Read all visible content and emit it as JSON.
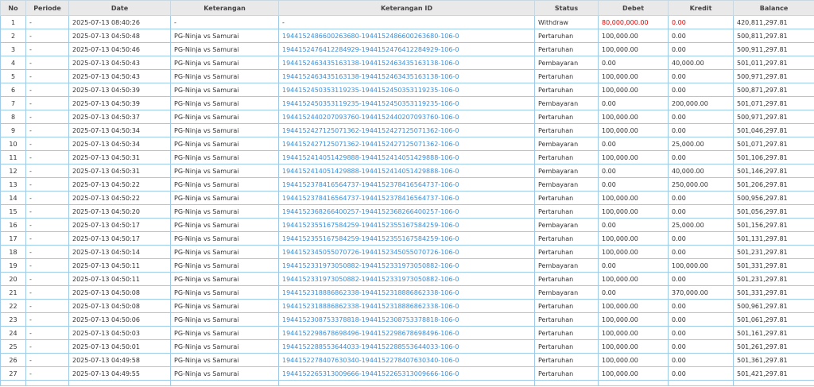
{
  "headers": [
    "No",
    "Periode",
    "Date",
    "Keterangan",
    "Keterangan ID",
    "Status",
    "Debet",
    "Kredit",
    "Balance"
  ],
  "rows": [
    {
      "no": "1",
      "periode": "-",
      "date": "2025-07-13 08:40:26",
      "keterangan": "-",
      "keterangan_id": "-",
      "status": "Withdraw",
      "debet": "80,000,000.00",
      "kredit": "0.00",
      "balance": "420,811,297.81"
    },
    {
      "no": "2",
      "periode": "-",
      "date": "2025-07-13 04:50:48",
      "keterangan": "PG-Ninja vs Samurai",
      "keterangan_id": "1944152486600263680-1944152486600263680-106-0",
      "status": "Pertaruhan",
      "debet": "100,000.00",
      "kredit": "0.00",
      "balance": "500,811,297.81"
    },
    {
      "no": "3",
      "periode": "-",
      "date": "2025-07-13 04:50:46",
      "keterangan": "PG-Ninja vs Samurai",
      "keterangan_id": "1944152476412284929-1944152476412284929-106-0",
      "status": "Pertaruhan",
      "debet": "100,000.00",
      "kredit": "0.00",
      "balance": "500,911,297.81"
    },
    {
      "no": "4",
      "periode": "-",
      "date": "2025-07-13 04:50:43",
      "keterangan": "PG-Ninja vs Samurai",
      "keterangan_id": "1944152463435163138-1944152463435163138-106-0",
      "status": "Pembayaran",
      "debet": "0.00",
      "kredit": "40,000.00",
      "balance": "501,011,297.81"
    },
    {
      "no": "5",
      "periode": "-",
      "date": "2025-07-13 04:50:43",
      "keterangan": "PG-Ninja vs Samurai",
      "keterangan_id": "1944152463435163138-1944152463435163138-106-0",
      "status": "Pertaruhan",
      "debet": "100,000.00",
      "kredit": "0.00",
      "balance": "500,971,297.81"
    },
    {
      "no": "6",
      "periode": "-",
      "date": "2025-07-13 04:50:39",
      "keterangan": "PG-Ninja vs Samurai",
      "keterangan_id": "1944152450353119235-1944152450353119235-106-0",
      "status": "Pertaruhan",
      "debet": "100,000.00",
      "kredit": "0.00",
      "balance": "500,871,297.81"
    },
    {
      "no": "7",
      "periode": "-",
      "date": "2025-07-13 04:50:39",
      "keterangan": "PG-Ninja vs Samurai",
      "keterangan_id": "1944152450353119235-1944152450353119235-106-0",
      "status": "Pembayaran",
      "debet": "0.00",
      "kredit": "200,000.00",
      "balance": "501,071,297.81"
    },
    {
      "no": "8",
      "periode": "-",
      "date": "2025-07-13 04:50:37",
      "keterangan": "PG-Ninja vs Samurai",
      "keterangan_id": "1944152440207093760-1944152440207093760-106-0",
      "status": "Pertaruhan",
      "debet": "100,000.00",
      "kredit": "0.00",
      "balance": "500,971,297.81"
    },
    {
      "no": "9",
      "periode": "-",
      "date": "2025-07-13 04:50:34",
      "keterangan": "PG-Ninja vs Samurai",
      "keterangan_id": "1944152427125071362-1944152427125071362-106-0",
      "status": "Pertaruhan",
      "debet": "100,000.00",
      "kredit": "0.00",
      "balance": "501,046,297.81"
    },
    {
      "no": "10",
      "periode": "-",
      "date": "2025-07-13 04:50:34",
      "keterangan": "PG-Ninja vs Samurai",
      "keterangan_id": "1944152427125071362-1944152427125071362-106-0",
      "status": "Pembayaran",
      "debet": "0.00",
      "kredit": "25,000.00",
      "balance": "501,071,297.81"
    },
    {
      "no": "11",
      "periode": "-",
      "date": "2025-07-13 04:50:31",
      "keterangan": "PG-Ninja vs Samurai",
      "keterangan_id": "1944152414051429888-1944152414051429888-106-0",
      "status": "Pertaruhan",
      "debet": "100,000.00",
      "kredit": "0.00",
      "balance": "501,106,297.81"
    },
    {
      "no": "12",
      "periode": "-",
      "date": "2025-07-13 04:50:31",
      "keterangan": "PG-Ninja vs Samurai",
      "keterangan_id": "1944152414051429888-1944152414051429888-106-0",
      "status": "Pembayaran",
      "debet": "0.00",
      "kredit": "40,000.00",
      "balance": "501,146,297.81"
    },
    {
      "no": "13",
      "periode": "-",
      "date": "2025-07-13 04:50:22",
      "keterangan": "PG-Ninja vs Samurai",
      "keterangan_id": "1944152378416564737-1944152378416564737-106-0",
      "status": "Pembayaran",
      "debet": "0.00",
      "kredit": "250,000.00",
      "balance": "501,206,297.81"
    },
    {
      "no": "14",
      "periode": "-",
      "date": "2025-07-13 04:50:22",
      "keterangan": "PG-Ninja vs Samurai",
      "keterangan_id": "1944152378416564737-1944152378416564737-106-0",
      "status": "Pertaruhan",
      "debet": "100,000.00",
      "kredit": "0.00",
      "balance": "500,956,297.81"
    },
    {
      "no": "15",
      "periode": "-",
      "date": "2025-07-13 04:50:20",
      "keterangan": "PG-Ninja vs Samurai",
      "keterangan_id": "1944152368266400257-1944152368266400257-106-0",
      "status": "Pertaruhan",
      "debet": "100,000.00",
      "kredit": "0.00",
      "balance": "501,056,297.81"
    },
    {
      "no": "16",
      "periode": "-",
      "date": "2025-07-13 04:50:17",
      "keterangan": "PG-Ninja vs Samurai",
      "keterangan_id": "1944152355167584259-1944152355167584259-106-0",
      "status": "Pembayaran",
      "debet": "0.00",
      "kredit": "25,000.00",
      "balance": "501,156,297.81"
    },
    {
      "no": "17",
      "periode": "-",
      "date": "2025-07-13 04:50:17",
      "keterangan": "PG-Ninja vs Samurai",
      "keterangan_id": "1944152355167584259-1944152355167584259-106-0",
      "status": "Pertaruhan",
      "debet": "100,000.00",
      "kredit": "0.00",
      "balance": "501,131,297.81"
    },
    {
      "no": "18",
      "periode": "-",
      "date": "2025-07-13 04:50:14",
      "keterangan": "PG-Ninja vs Samurai",
      "keterangan_id": "1944152345055070726-1944152345055070726-106-0",
      "status": "Pertaruhan",
      "debet": "100,000.00",
      "kredit": "0.00",
      "balance": "501,231,297.81"
    },
    {
      "no": "19",
      "periode": "-",
      "date": "2025-07-13 04:50:11",
      "keterangan": "PG-Ninja vs Samurai",
      "keterangan_id": "1944152331973050882-1944152331973050882-106-0",
      "status": "Pembayaran",
      "debet": "0.00",
      "kredit": "100,000.00",
      "balance": "501,331,297.81"
    },
    {
      "no": "20",
      "periode": "-",
      "date": "2025-07-13 04:50:11",
      "keterangan": "PG-Ninja vs Samurai",
      "keterangan_id": "1944152331973050882-1944152331973050882-106-0",
      "status": "Pertaruhan",
      "debet": "100,000.00",
      "kredit": "0.00",
      "balance": "501,231,297.81"
    },
    {
      "no": "21",
      "periode": "-",
      "date": "2025-07-13 04:50:08",
      "keterangan": "PG-Ninja vs Samurai",
      "keterangan_id": "1944152318886862338-1944152318886862338-106-0",
      "status": "Pembayaran",
      "debet": "0.00",
      "kredit": "370,000.00",
      "balance": "501,331,297.81"
    },
    {
      "no": "22",
      "periode": "-",
      "date": "2025-07-13 04:50:08",
      "keterangan": "PG-Ninja vs Samurai",
      "keterangan_id": "1944152318886862338-1944152318886862338-106-0",
      "status": "Pertaruhan",
      "debet": "100,000.00",
      "kredit": "0.00",
      "balance": "500,961,297.81"
    },
    {
      "no": "23",
      "periode": "-",
      "date": "2025-07-13 04:50:06",
      "keterangan": "PG-Ninja vs Samurai",
      "keterangan_id": "1944152308753378818-1944152308753378818-106-0",
      "status": "Pertaruhan",
      "debet": "100,000.00",
      "kredit": "0.00",
      "balance": "501,061,297.81"
    },
    {
      "no": "24",
      "periode": "-",
      "date": "2025-07-13 04:50:03",
      "keterangan": "PG-Ninja vs Samurai",
      "keterangan_id": "1944152298678698496-1944152298678698496-106-0",
      "status": "Pertaruhan",
      "debet": "100,000.00",
      "kredit": "0.00",
      "balance": "501,161,297.81"
    },
    {
      "no": "25",
      "periode": "-",
      "date": "2025-07-13 04:50:01",
      "keterangan": "PG-Ninja vs Samurai",
      "keterangan_id": "1944152288553644033-1944152288553644033-106-0",
      "status": "Pertaruhan",
      "debet": "100,000.00",
      "kredit": "0.00",
      "balance": "501,261,297.81"
    },
    {
      "no": "26",
      "periode": "-",
      "date": "2025-07-13 04:49:58",
      "keterangan": "PG-Ninja vs Samurai",
      "keterangan_id": "1944152278407630340-1944152278407630340-106-0",
      "status": "Pertaruhan",
      "debet": "100,000.00",
      "kredit": "0.00",
      "balance": "501,361,297.81"
    },
    {
      "no": "27",
      "periode": "-",
      "date": "2025-07-13 04:49:55",
      "keterangan": "PG-Ninja vs Samurai",
      "keterangan_id": "1944152265313009666-1944152265313009666-106-0",
      "status": "Pertaruhan",
      "debet": "100,000.00",
      "kredit": "0.00",
      "balance": "501,421,297.81"
    }
  ],
  "colors": {
    "link": "#3b8ed6",
    "negative": "#e00000",
    "border": "#9ecbe8",
    "header_bg": "#e9e9e9"
  }
}
